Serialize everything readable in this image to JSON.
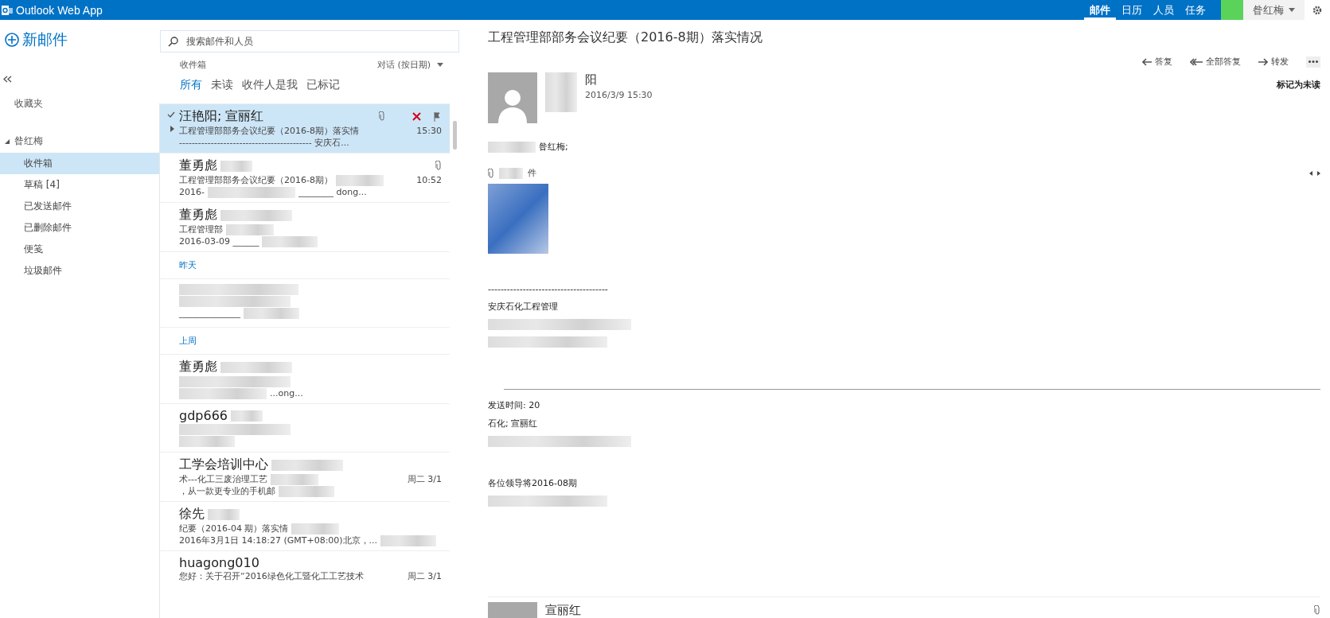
{
  "app_title": "Outlook Web App",
  "nav": [
    {
      "label": "邮件",
      "selected": true
    },
    {
      "label": "日历",
      "selected": false
    },
    {
      "label": "人员",
      "selected": false
    },
    {
      "label": "任务",
      "selected": false
    }
  ],
  "user": "昝红梅",
  "new_mail": "新邮件",
  "favorites": "收藏夹",
  "folder_group": {
    "name": "昝红梅",
    "expanded": true,
    "folders": [
      {
        "label": "收件箱",
        "selected": true
      },
      {
        "label": "草稿 [4]",
        "selected": false
      },
      {
        "label": "已发送邮件",
        "selected": false
      },
      {
        "label": "已删除邮件",
        "selected": false
      },
      {
        "label": "便笺",
        "selected": false
      },
      {
        "label": "垃圾邮件",
        "selected": false
      }
    ]
  },
  "search": {
    "placeholder": "搜索邮件和人员"
  },
  "list_title": "收件箱",
  "sort": "对话 (按日期)",
  "filters": [
    {
      "label": "所有",
      "selected": true
    },
    {
      "label": "未读",
      "selected": false
    },
    {
      "label": "收件人是我",
      "selected": false
    },
    {
      "label": "已标记",
      "selected": false
    }
  ],
  "sections": [
    {
      "messages": [
        {
          "sender": "汪艳阳; 宣丽红",
          "subject": "工程管理部部务会议纪要（2016-8期）落实情",
          "preview": "------------------------------------------ 安庆石...",
          "time": "15:30",
          "attachment": true,
          "selected": true,
          "redacted": false
        },
        {
          "sender": "董勇彪",
          "subject": "工程管理部部务会议纪要（2016-8期）",
          "preview": "2016-",
          "preview_tail": "________ dong...",
          "time": "10:52",
          "attachment": true,
          "selected": false,
          "redacted": true
        },
        {
          "sender": "董勇彪",
          "subject": "工程管理部",
          "preview": "2016-03-09 ______",
          "selected": false,
          "attachment": false,
          "redacted": true
        }
      ]
    },
    {
      "heading": "昨天",
      "messages": [
        {
          "preview": "______________",
          "selected": false,
          "attachment": false,
          "redacted": true
        }
      ]
    },
    {
      "heading": "上周",
      "messages": [
        {
          "sender": "董勇彪",
          "preview_tail": "...ong...",
          "selected": false,
          "attachment": false,
          "redacted": true
        },
        {
          "sender": "gdp666",
          "selected": false,
          "attachment": false,
          "redacted": true
        },
        {
          "sender": "工学会培训中心",
          "subject": "术---化工三废治理工艺",
          "preview": "，从一款更专业的手机邮",
          "time": "周二 3/1",
          "selected": false,
          "attachment": false,
          "redacted": true
        },
        {
          "sender": "徐先",
          "subject": "纪要（2016-04 期）落实情",
          "preview": "2016年3月1日 14:18:27 (GMT+08:00)北京，...",
          "selected": false,
          "attachment": false,
          "redacted": true
        },
        {
          "sender": "huagong010",
          "subject": "您好：关于召开“2016绿色化工暨化工工艺技术",
          "time": "周二 3/1",
          "selected": false,
          "attachment": false,
          "redacted": false
        }
      ]
    }
  ],
  "reading": {
    "subject": "工程管理部部务会议纪要（2016-8期）落实情况",
    "actions": [
      {
        "label": "答复",
        "kind": "reply"
      },
      {
        "label": "全部答复",
        "kind": "replyall"
      },
      {
        "label": "转发",
        "kind": "forward"
      }
    ],
    "mark_unread": "标记为未读",
    "sender": "阳",
    "date": "2016/3/9 15:30",
    "recipients": "昝红梅;",
    "attachments_label": "件",
    "body": [
      {
        "kind": "text",
        "text": "--------------------------------------"
      },
      {
        "kind": "text",
        "text": "安庆石化工程管理"
      },
      {
        "kind": "redacted"
      },
      {
        "kind": "redacted"
      },
      {
        "kind": "gap"
      },
      {
        "kind": "rule"
      },
      {
        "kind": "text",
        "text": "发送时间: 20"
      },
      {
        "kind": "text",
        "text": "石化; 宣丽红"
      },
      {
        "kind": "redacted"
      },
      {
        "kind": "gap"
      },
      {
        "kind": "text",
        "text": "各位领导将2016-08期"
      },
      {
        "kind": "redacted"
      }
    ],
    "next_sender": "宣丽红"
  }
}
